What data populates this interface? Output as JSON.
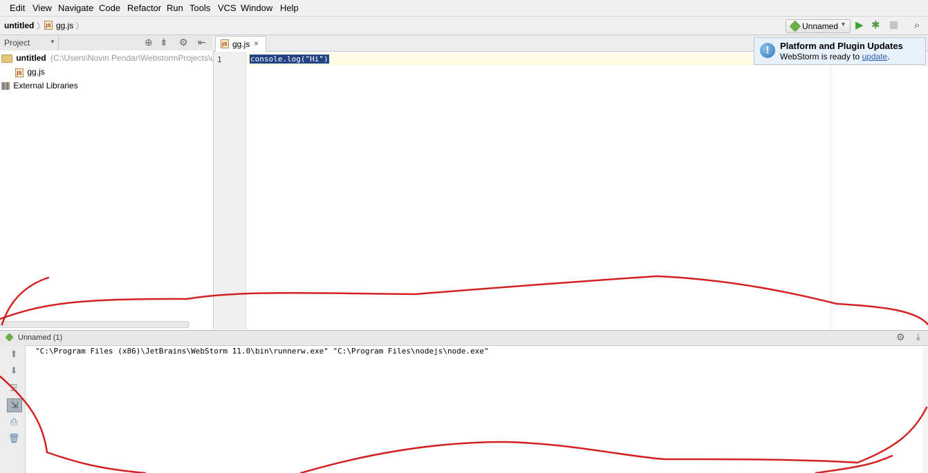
{
  "menu": [
    "Edit",
    "View",
    "Navigate",
    "Code",
    "Refactor",
    "Run",
    "Tools",
    "VCS",
    "Window",
    "Help"
  ],
  "breadcrumb": {
    "project": "untitled",
    "file": "gg.js"
  },
  "run_config": {
    "label": "Unnamed"
  },
  "project_panel": {
    "title": "Project",
    "root": {
      "name": "untitled",
      "path": "(C:\\Users\\Novin Pendar\\WebstormProjects\\ur"
    },
    "file": "gg.js",
    "libraries": "External Libraries"
  },
  "editor": {
    "tab": "gg.js",
    "tab_close": "×",
    "line_number": "1",
    "code": "console.log(\"Hi\")"
  },
  "notification": {
    "title": "Platform and Plugin Updates",
    "text": "WebStorm is ready to",
    "link": "update",
    "end": "."
  },
  "run_panel": {
    "tab": "Unnamed (1)",
    "console": "\"C:\\Program Files (x86)\\JetBrains\\WebStorm 11.0\\bin\\runnerw.exe\" \"C:\\Program Files\\nodejs\\node.exe\""
  },
  "colors": {
    "selection": "#214283",
    "current_line": "#fffae3",
    "annotation": "#d42020"
  }
}
